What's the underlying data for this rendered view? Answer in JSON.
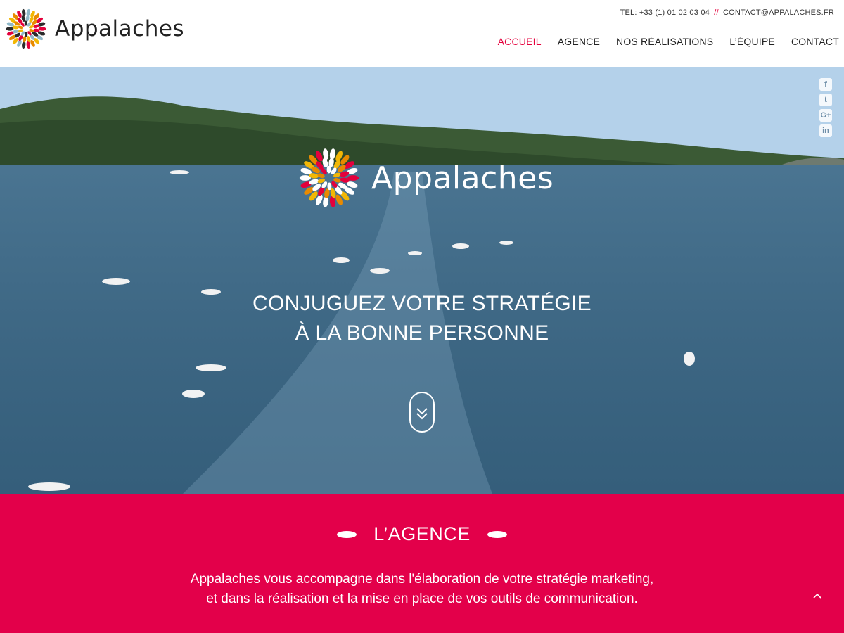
{
  "brand": {
    "name": "Appalaches"
  },
  "header": {
    "phone": "TEL: +33 (1) 01 02 03 04",
    "separator": "//",
    "email": "CONTACT@APPALACHES.FR"
  },
  "nav": {
    "items": [
      {
        "label": "ACCUEIL",
        "active": true
      },
      {
        "label": "AGENCE"
      },
      {
        "label": "NOS RÉALISATIONS"
      },
      {
        "label": "L’ÉQUIPE"
      },
      {
        "label": "CONTACT"
      }
    ]
  },
  "hero": {
    "brand_name": "Appalaches",
    "tagline_line1": "CONJUGUEZ VOTRE STRATÉGIE",
    "tagline_line2": "À LA BONNE PERSONNE",
    "social": [
      {
        "icon": "facebook-icon",
        "glyph": "f"
      },
      {
        "icon": "twitter-icon",
        "glyph": "t"
      },
      {
        "icon": "google-plus-icon",
        "glyph": "G+"
      },
      {
        "icon": "linkedin-icon",
        "glyph": "in"
      }
    ]
  },
  "agence": {
    "title": "L’AGENCE",
    "text_line1": "Appalaches vous accompagne dans l'élaboration de votre stratégie marketing,",
    "text_line2": "et dans la réalisation et la mise en place de vos outils de communication."
  },
  "colors": {
    "accent": "#e3004a",
    "nav_active": "#e4003c",
    "logo_petals": [
      "#e4003c",
      "#f2b705",
      "#2b2b2b",
      "#e88a00",
      "#8fb8c9"
    ]
  }
}
